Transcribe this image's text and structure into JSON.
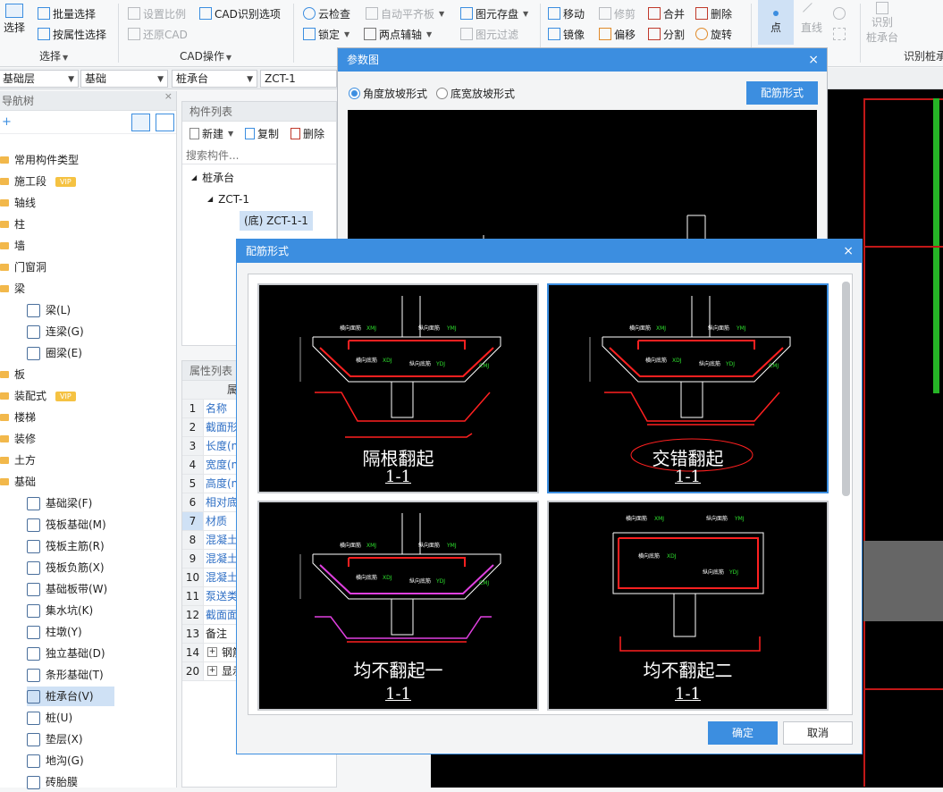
{
  "ribbon": {
    "select": {
      "big": "选择",
      "batch": "批量选择",
      "by_attr": "按属性选择",
      "group": "选择"
    },
    "cad": {
      "set_scale": "设置比例",
      "cad_opts": "CAD识别选项",
      "restore": "还原CAD",
      "group": "CAD操作"
    },
    "general": {
      "cloud_check": "云检查",
      "auto_flat": "自动平齐板",
      "lock": "锁定",
      "two_point_axis": "两点辅轴",
      "save_elem": "图元存盘",
      "elem_filter": "图元过滤"
    },
    "modify": {
      "move": "移动",
      "trim": "修剪",
      "merge": "合并",
      "delete": "删除",
      "mirror": "镜像",
      "offset": "偏移",
      "split": "分割",
      "rotate": "旋转"
    },
    "draw": {
      "point": "点",
      "line": "直线"
    },
    "recognize": {
      "btn_line1": "识别",
      "btn_line2": "桩承台",
      "group": "识别桩承"
    }
  },
  "selectors": {
    "floor": "基础层",
    "type": "基础",
    "subtype": "桩承台",
    "component": "ZCT-1"
  },
  "nav": {
    "title": "导航树",
    "items": [
      "常用构件类型",
      "施工段",
      "轴线",
      "柱",
      "墙",
      "门窗洞",
      "梁",
      "梁(L)",
      "连梁(G)",
      "圈梁(E)",
      "板",
      "装配式",
      "楼梯",
      "装修",
      "土方",
      "基础",
      "基础梁(F)",
      "筏板基础(M)",
      "筏板主筋(R)",
      "筏板负筋(X)",
      "基础板带(W)",
      "集水坑(K)",
      "柱墩(Y)",
      "独立基础(D)",
      "条形基础(T)",
      "桩承台(V)",
      "桩(U)",
      "垫层(X)",
      "地沟(G)",
      "砖胎膜"
    ],
    "vip": "VIP"
  },
  "comp_list": {
    "title": "构件列表",
    "new": "新建",
    "copy": "复制",
    "delete": "删除",
    "search_placeholder": "搜索构件...",
    "tree": [
      "桩承台",
      "ZCT-1",
      "(底) ZCT-1-1"
    ]
  },
  "prop_list": {
    "title": "属性列表",
    "col": "属",
    "rows": [
      {
        "n": "1",
        "name": "名称"
      },
      {
        "n": "2",
        "name": "截面形"
      },
      {
        "n": "3",
        "name": "长度(n"
      },
      {
        "n": "4",
        "name": "宽度(n"
      },
      {
        "n": "5",
        "name": "高度(n"
      },
      {
        "n": "6",
        "name": "相对底"
      },
      {
        "n": "7",
        "name": "材质"
      },
      {
        "n": "8",
        "name": "混凝土"
      },
      {
        "n": "9",
        "name": "混凝土"
      },
      {
        "n": "10",
        "name": "混凝土"
      },
      {
        "n": "11",
        "name": "泵送类"
      },
      {
        "n": "12",
        "name": "截面面"
      },
      {
        "n": "13",
        "name": "备注"
      },
      {
        "n": "14",
        "name": "钢筋"
      },
      {
        "n": "20",
        "name": "显示"
      }
    ]
  },
  "param_dialog": {
    "title": "参数图",
    "close": "×",
    "radio1": "角度放坡形式",
    "radio2": "底宽放坡形式",
    "rebar_btn": "配筋形式"
  },
  "rebar_dialog": {
    "title": "配筋形式",
    "close": "×",
    "options": [
      {
        "name": "隔根翻起",
        "section": "1-1"
      },
      {
        "name": "交错翻起",
        "section": "1-1"
      },
      {
        "name": "均不翻起一",
        "section": "1-1"
      },
      {
        "name": "均不翻起二",
        "section": "1-1"
      }
    ],
    "labels": {
      "top_h": "横向面筋",
      "top_v": "纵向面筋",
      "bot_h": "横向底筋",
      "bot_v": "纵向底筋"
    },
    "ok": "确定",
    "cancel": "取消"
  },
  "colors": {
    "accent": "#3c8ee0",
    "rebar_red": "#ff2020",
    "label_green": "#2ee02e",
    "magenta": "#e040e0"
  }
}
